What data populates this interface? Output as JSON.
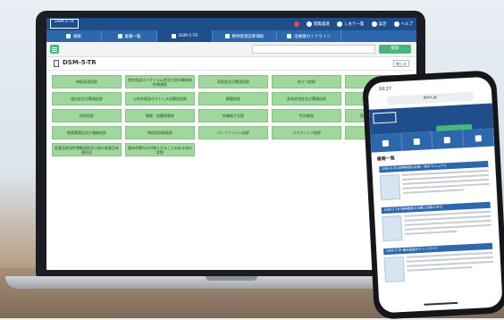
{
  "app": {
    "logo_text": "DSM-5-TR",
    "top_actions": [
      {
        "label": "閲覧履歴",
        "icon": "history-icon"
      },
      {
        "label": "しおり一覧",
        "icon": "bookmark-icon"
      },
      {
        "label": "設定",
        "icon": "gear-icon"
      },
      {
        "label": "ヘルプ",
        "icon": "help-icon"
      }
    ]
  },
  "nav": {
    "tabs": [
      {
        "label": "検索",
        "icon": "search-icon"
      },
      {
        "label": "書籍一覧",
        "icon": "books-icon"
      },
      {
        "label": "DSM-5-TR",
        "icon": "document-icon"
      },
      {
        "label": "精神疾患診断補助",
        "icon": "heart-icon"
      },
      {
        "label": "治療薬ガイドライン",
        "icon": "pill-icon"
      }
    ]
  },
  "toolbar": {
    "search_placeholder": "",
    "search_button": "検索"
  },
  "page": {
    "title": "DSM-5-TR",
    "close_label": "閉じる"
  },
  "categories": [
    "神経発達症群",
    "統合失調スペクトラム症及び他の精神病性障害群",
    "双極症及び関連症群",
    "抑うつ症群",
    "不安症群",
    "強迫症及び関連症群",
    "心的外傷及びストレス因関連症群",
    "解離症群",
    "身体症状症及び関連症群",
    "食行動症及び摂食症群",
    "排泄症群",
    "睡眠・覚醒障害群",
    "性機能不全群",
    "性別違和",
    "秩序破壊的・衝動制御群",
    "物質関連症及び嗜癖症群",
    "神経認知障害群",
    "パーソナリティ症群",
    "パラフィリア症群",
    "他の精神疾患群",
    "医薬品誘発性運動症群及び他の医薬品有害作用",
    "臨床的関与の対象となることのある他の状態"
  ],
  "phone": {
    "time": "10:27",
    "url": "dsm.jp",
    "section_title": "書籍一覧",
    "items": [
      "DSM-5-TR 精神疾患の診断・統計マニュアル",
      "DSM-5-TR 精神疾患の分類と診断の手引",
      "DSM-5-TR 臨床面接ポケットガイド"
    ]
  }
}
